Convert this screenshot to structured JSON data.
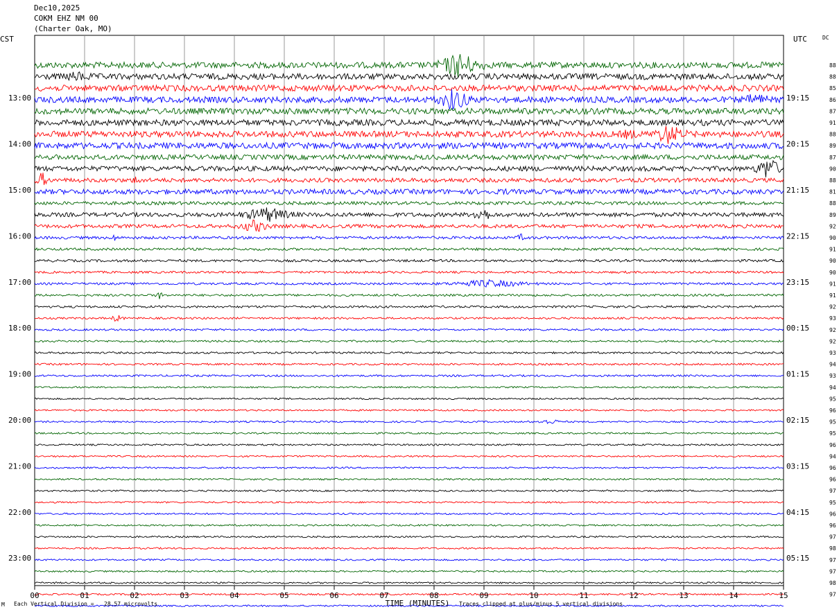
{
  "header": {
    "date": "Dec10,2025",
    "station": "COKM EHZ NM 00",
    "location": "(Charter Oak, MO)"
  },
  "left_zone": "CST",
  "right_zone": "UTC",
  "dc_label": "DC",
  "footer": {
    "scale_note": "Each Vertical Division =   28.57 microvolts",
    "clip_note": "Traces clipped at plus/minus 5 vertical divisions",
    "small_mark": "M"
  },
  "colors": {
    "trace_cycle": [
      "#006400",
      "#000000",
      "#ff0000",
      "#0000ff"
    ],
    "grid": "#808080"
  },
  "chart_data": {
    "type": "line",
    "title": "COKM EHZ NM 00",
    "xlabel": "TIME (MINUTES)",
    "xlim": [
      0,
      15
    ],
    "x_ticks": [
      "00",
      "01",
      "02",
      "03",
      "04",
      "05",
      "06",
      "07",
      "08",
      "09",
      "10",
      "11",
      "12",
      "13",
      "14",
      "15"
    ],
    "trace_count": 48,
    "traces_per_hour": 4,
    "left_hour_labels": [
      {
        "row": 2,
        "label": "13:00"
      },
      {
        "row": 6,
        "label": "14:00"
      },
      {
        "row": 10,
        "label": "15:00"
      },
      {
        "row": 14,
        "label": "16:00"
      },
      {
        "row": 18,
        "label": "17:00"
      },
      {
        "row": 22,
        "label": "18:00"
      },
      {
        "row": 26,
        "label": "19:00"
      },
      {
        "row": 30,
        "label": "20:00"
      },
      {
        "row": 34,
        "label": "21:00"
      },
      {
        "row": 38,
        "label": "22:00"
      },
      {
        "row": 42,
        "label": "23:00"
      }
    ],
    "right_hour_labels": [
      {
        "row": 2,
        "label": "19:15"
      },
      {
        "row": 6,
        "label": "20:15"
      },
      {
        "row": 10,
        "label": "21:15"
      },
      {
        "row": 14,
        "label": "22:15"
      },
      {
        "row": 18,
        "label": "23:15"
      },
      {
        "row": 22,
        "label": "00:15"
      },
      {
        "row": 26,
        "label": "01:15"
      },
      {
        "row": 30,
        "label": "02:15"
      },
      {
        "row": 34,
        "label": "03:15"
      },
      {
        "row": 38,
        "label": "04:15"
      },
      {
        "row": 42,
        "label": "05:15"
      }
    ],
    "dc_offsets": [
      88,
      88,
      85,
      86,
      87,
      91,
      88,
      89,
      87,
      90,
      88,
      81,
      88,
      89,
      92,
      90,
      91,
      90,
      90,
      91,
      91,
      92,
      93,
      92,
      92,
      93,
      94,
      93,
      94,
      95,
      96,
      95,
      95,
      96,
      94,
      96,
      96,
      97,
      95,
      96,
      96,
      97,
      98,
      97,
      97,
      98,
      97
    ],
    "amplitude": [
      2.2,
      2.2,
      2.2,
      2.2,
      2.2,
      2.2,
      2.2,
      2.2,
      1.8,
      1.8,
      1.5,
      1.8,
      1.2,
      1.5,
      1.3,
      1,
      0.9,
      0.9,
      0.8,
      0.8,
      0.8,
      0.8,
      0.7,
      0.7,
      0.7,
      0.7,
      0.7,
      0.7,
      0.6,
      0.6,
      0.6,
      0.6,
      0.6,
      0.6,
      0.6,
      0.6,
      0.6,
      0.6,
      0.6,
      0.6,
      0.6,
      0.6,
      0.6,
      0.6,
      0.6,
      0.6,
      0.6,
      0.6
    ],
    "events": [
      {
        "row": 0,
        "start": 8.0,
        "end": 9.0,
        "amp": 10
      },
      {
        "row": 3,
        "start": 8.0,
        "end": 8.8,
        "amp": 9
      },
      {
        "row": 3,
        "start": 14.0,
        "end": 14.9,
        "amp": 5
      },
      {
        "row": 1,
        "start": 0.2,
        "end": 1.5,
        "amp": 4
      },
      {
        "row": 6,
        "start": 12.3,
        "end": 13.1,
        "amp": 8
      },
      {
        "row": 6,
        "start": 11.5,
        "end": 12.3,
        "amp": 4
      },
      {
        "row": 9,
        "start": 14.4,
        "end": 15.0,
        "amp": 9
      },
      {
        "row": 10,
        "start": 0.0,
        "end": 0.3,
        "amp": 6
      },
      {
        "row": 10,
        "start": 1.9,
        "end": 2.2,
        "amp": 4
      },
      {
        "row": 11,
        "start": 9.2,
        "end": 9.6,
        "amp": 3
      },
      {
        "row": 13,
        "start": 8.7,
        "end": 9.2,
        "amp": 6
      },
      {
        "row": 13,
        "start": 4.0,
        "end": 5.3,
        "amp": 6
      },
      {
        "row": 14,
        "start": 4.0,
        "end": 4.8,
        "amp": 5
      },
      {
        "row": 15,
        "start": 1.5,
        "end": 1.7,
        "amp": 3
      },
      {
        "row": 15,
        "start": 9.6,
        "end": 9.9,
        "amp": 3
      },
      {
        "row": 19,
        "start": 8.0,
        "end": 10.2,
        "amp": 3
      },
      {
        "row": 20,
        "start": 2.4,
        "end": 2.6,
        "amp": 3
      },
      {
        "row": 22,
        "start": 1.5,
        "end": 1.8,
        "amp": 3
      },
      {
        "row": 31,
        "start": 9.9,
        "end": 10.7,
        "amp": 2
      }
    ]
  }
}
